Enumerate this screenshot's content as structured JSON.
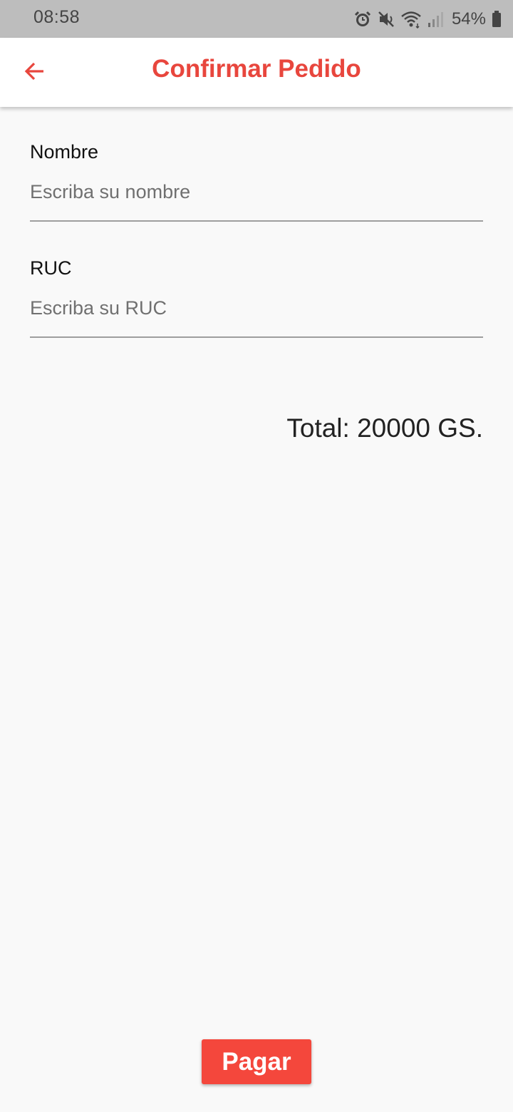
{
  "status_bar": {
    "time": "08:58",
    "battery_percent": "54%",
    "icons": [
      "alarm-icon",
      "mute-icon",
      "wifi-icon",
      "signal-icon",
      "battery-icon"
    ]
  },
  "app_bar": {
    "title": "Confirmar Pedido",
    "back_icon": "arrow-left-icon",
    "accent_color": "#e8463d"
  },
  "form": {
    "name": {
      "label": "Nombre",
      "placeholder": "Escriba su nombre",
      "value": ""
    },
    "ruc": {
      "label": "RUC",
      "placeholder": "Escriba su RUC",
      "value": ""
    }
  },
  "total": {
    "text": "Total: 20000 GS."
  },
  "pay_button": {
    "label": "Pagar",
    "color": "#f4473c"
  }
}
